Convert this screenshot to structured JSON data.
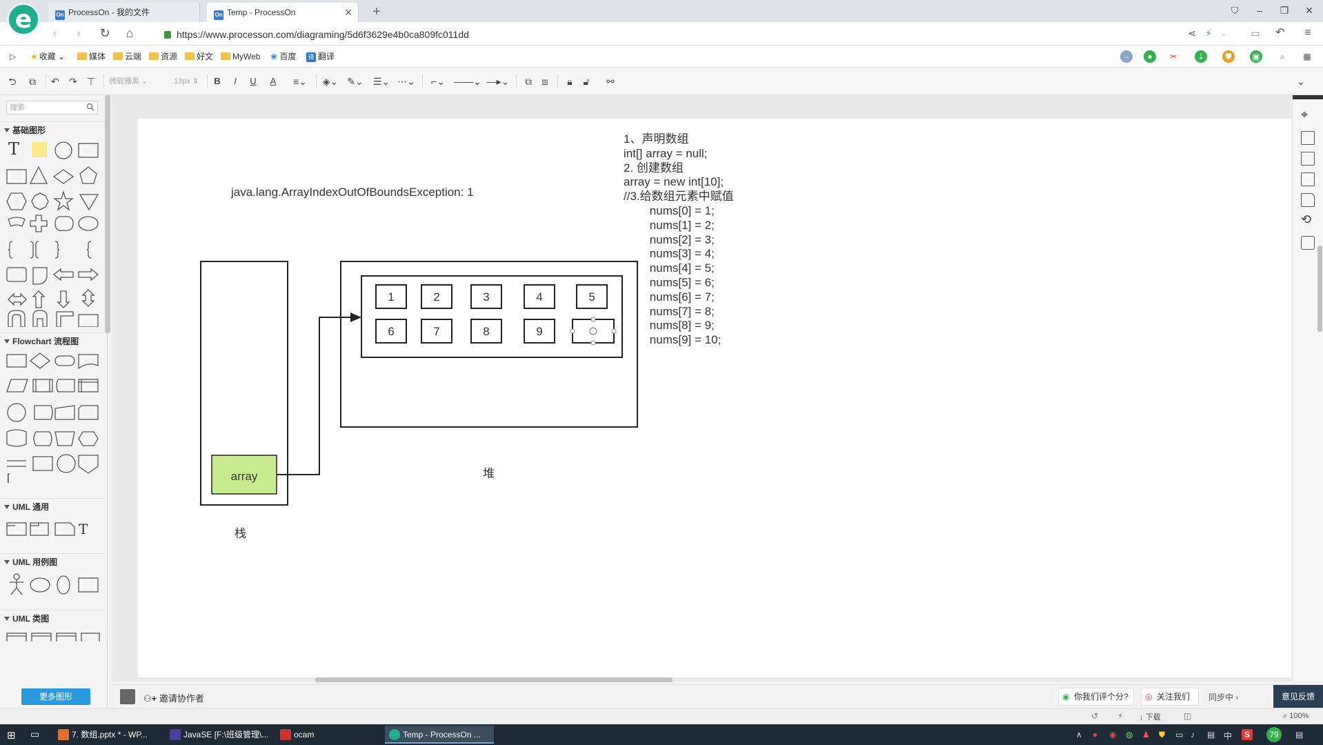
{
  "browser": {
    "tabs": [
      {
        "icon": "On",
        "title": "ProcessOn - 我的文件"
      },
      {
        "icon": "On",
        "title": "Temp - ProcessOn"
      }
    ],
    "url": "https://www.processon.com/diagraming/5d6f3629e4b0ca809fc011dd",
    "bookmarks": [
      "收藏",
      "媒体",
      "云端",
      "资源",
      "好文",
      "MyWeb",
      "百度",
      "翻译"
    ],
    "bookmark_icon_label": "译"
  },
  "toolbar": {
    "font_name": "微软雅黑",
    "font_size": "13px",
    "bold": "B",
    "italic": "I",
    "underline": "U",
    "font_color": "A"
  },
  "left_panel": {
    "search_placeholder": "搜索",
    "sections": [
      "基础图形",
      "Flowchart 流程图",
      "UML 通用",
      "UML 用例图",
      "UML 类图"
    ],
    "more_shapes": "更多图形"
  },
  "diagram": {
    "exception_text": "java.lang.ArrayIndexOutOfBoundsException: 1",
    "stack_label": "栈",
    "heap_label": "堆",
    "array_var": "array",
    "cells_row1": [
      "1",
      "2",
      "3",
      "4",
      "5"
    ],
    "cells_row2": [
      "6",
      "7",
      "8",
      "9",
      ""
    ],
    "code_lines": [
      "1、声明数组",
      "int[] array = null;",
      "",
      "2. 创建数组",
      "array = new int[10];",
      "",
      "//3.给数组元素中赋值",
      "        nums[0] = 1;",
      "        nums[1] = 2;",
      "        nums[2] = 3;",
      "        nums[3] = 4;",
      "        nums[4] = 5;",
      "        nums[5] = 6;",
      "        nums[6] = 7;",
      "        nums[7] = 8;",
      "        nums[8] = 9;",
      "        nums[9] = 10;"
    ],
    "array_fill_color": "#c7ec90"
  },
  "collab_bar": {
    "invite": "邀请协作者",
    "feedback_q": "你我们评个分?",
    "follow": "关注我们",
    "sync": "同步中",
    "feedback": "意见反馈"
  },
  "statusbar": {
    "download": "下载",
    "zoom": "100%"
  },
  "taskbar": {
    "items": [
      "7. 数组.pptx * - WP...",
      "JavaSE [F:\\班级管理\\...",
      "ocam",
      "Temp - ProcessOn ..."
    ],
    "tray_lang": "中",
    "tray_badge": "S",
    "tray_num": "79"
  },
  "colors": {
    "accent": "#2a9ae0",
    "logo": "#1fae8f",
    "array_green": "#c7ec90"
  }
}
